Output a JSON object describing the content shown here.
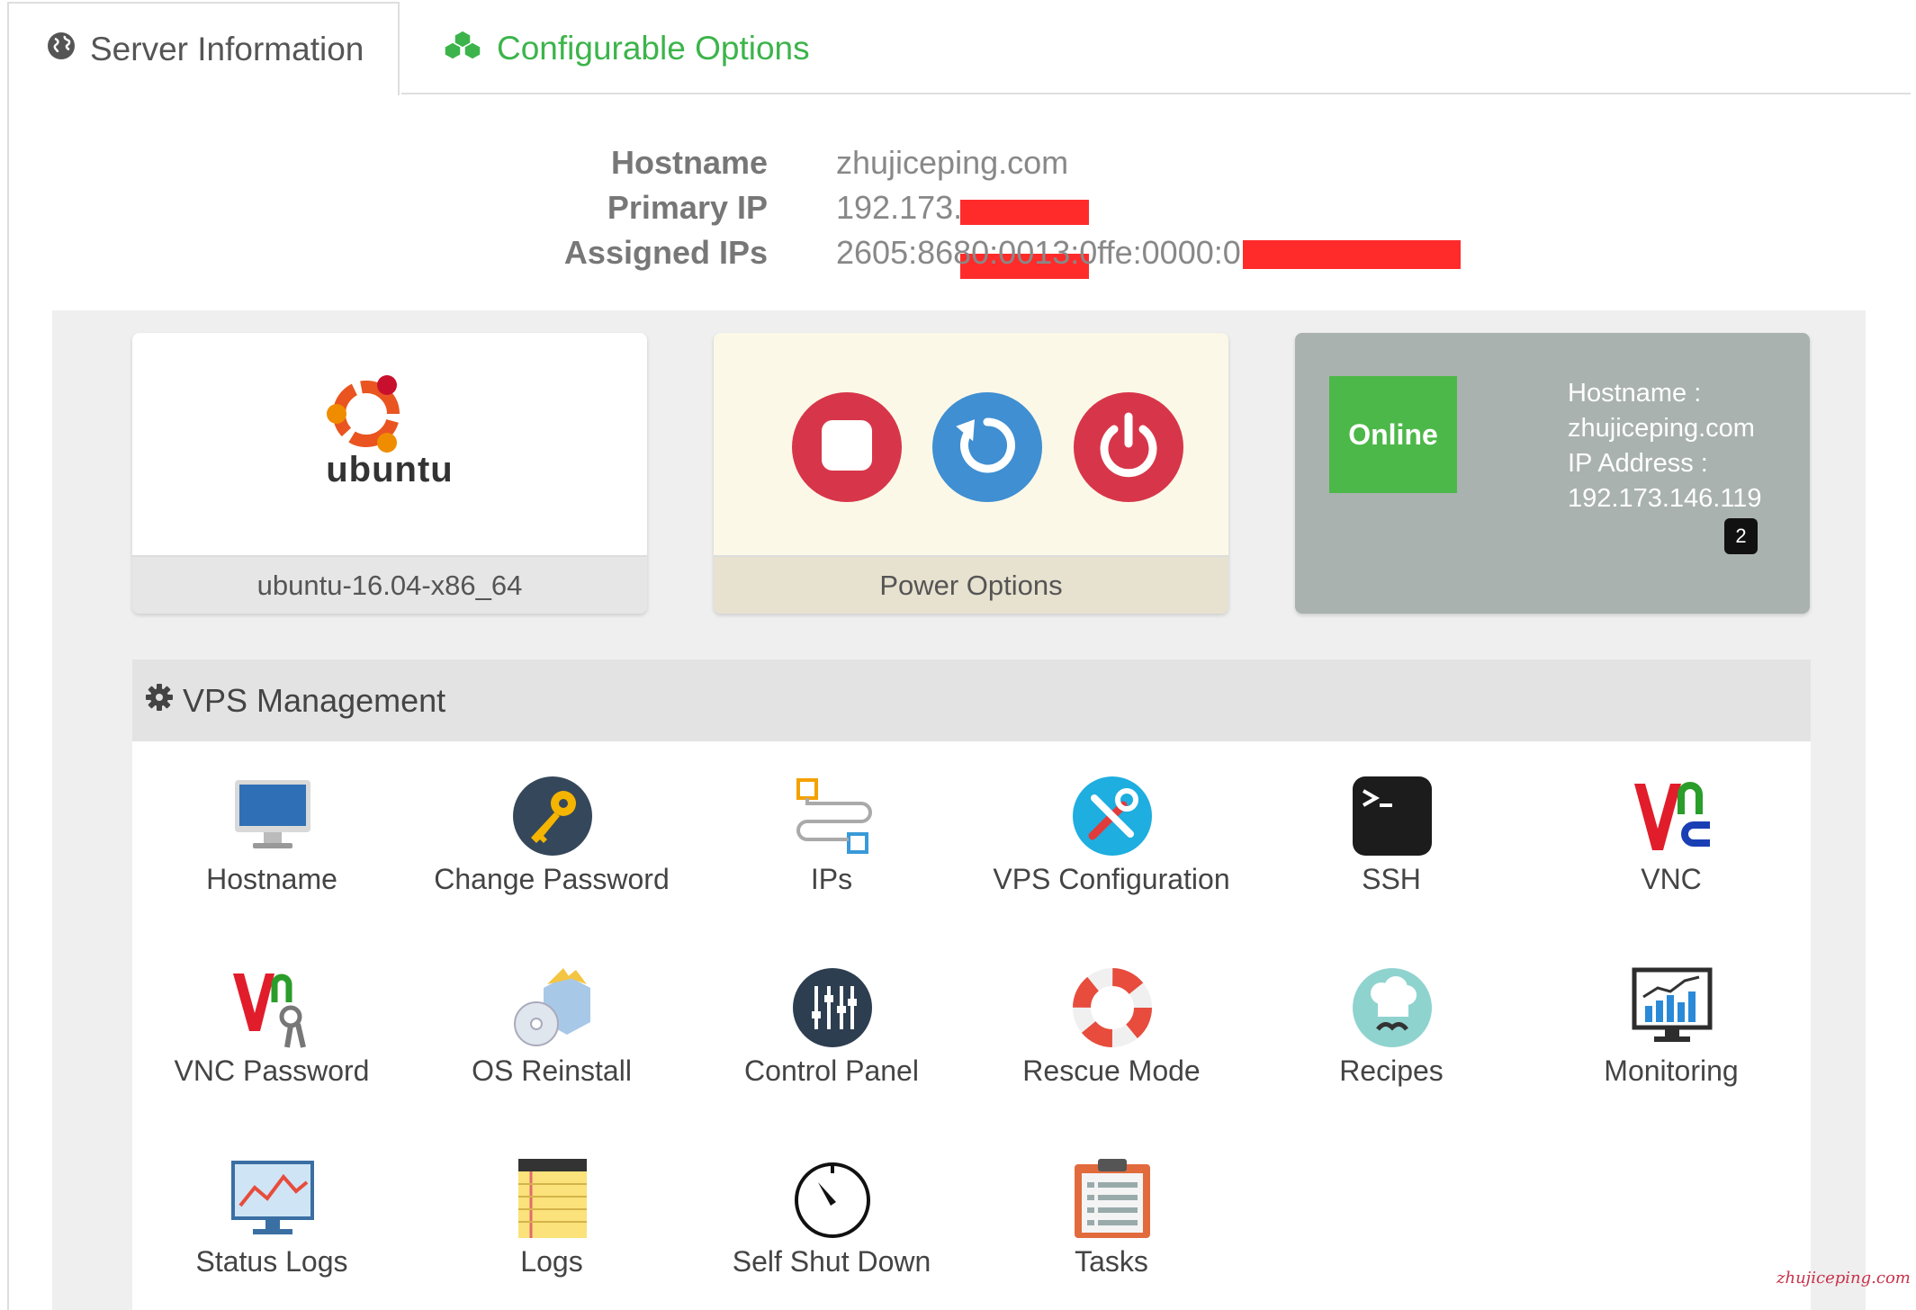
{
  "tabs": [
    {
      "label": "Server Information",
      "icon": "globe-icon",
      "active": true
    },
    {
      "label": "Configurable Options",
      "icon": "cubes-icon",
      "active": false
    }
  ],
  "server_info": {
    "hostname_label": "Hostname",
    "hostname_value": "zhujiceping.com",
    "primary_ip_label": "Primary IP",
    "primary_ip_value": "192.173.",
    "assigned_ips_label": "Assigned IPs",
    "assigned_ips_value": "2605:8680:0013:0ffe:0000:0"
  },
  "os_card": {
    "logo_text": "ubuntu",
    "label": "ubuntu-16.04-x86_64"
  },
  "power_card": {
    "label": "Power Options",
    "buttons": [
      {
        "name": "stop",
        "icon": "stop-icon",
        "color": "#d7364a"
      },
      {
        "name": "restart",
        "icon": "restart-icon",
        "color": "#3f8fd2"
      },
      {
        "name": "power-off",
        "icon": "power-icon",
        "color": "#d7364a"
      }
    ]
  },
  "status_card": {
    "status": "Online",
    "hostname_label": "Hostname :",
    "hostname_value": "zhujiceping.com",
    "ip_label": "IP Address :",
    "ip_value": "192.173.146.119",
    "badge_count": "2"
  },
  "vps_management": {
    "title": "VPS Management",
    "items": [
      {
        "label": "Hostname",
        "icon": "monitor-icon"
      },
      {
        "label": "Change Password",
        "icon": "key-icon"
      },
      {
        "label": "IPs",
        "icon": "network-icon"
      },
      {
        "label": "VPS Configuration",
        "icon": "tools-icon"
      },
      {
        "label": "SSH",
        "icon": "terminal-icon"
      },
      {
        "label": "VNC",
        "icon": "vnc-icon"
      },
      {
        "label": "VNC Password",
        "icon": "vnc-key-icon"
      },
      {
        "label": "OS Reinstall",
        "icon": "disc-box-icon"
      },
      {
        "label": "Control Panel",
        "icon": "sliders-icon"
      },
      {
        "label": "Rescue Mode",
        "icon": "lifebuoy-icon"
      },
      {
        "label": "Recipes",
        "icon": "chef-icon"
      },
      {
        "label": "Monitoring",
        "icon": "chart-monitor-icon"
      },
      {
        "label": "Status Logs",
        "icon": "line-chart-icon"
      },
      {
        "label": "Logs",
        "icon": "notepad-icon"
      },
      {
        "label": "Self Shut Down",
        "icon": "timer-icon"
      },
      {
        "label": "Tasks",
        "icon": "clipboard-icon"
      }
    ]
  },
  "watermark": "zhujiceping.com",
  "colors": {
    "accent_green": "#3cb44b",
    "online_green": "#4cb849",
    "danger_red": "#d7364a",
    "info_blue": "#3f8fd2"
  }
}
